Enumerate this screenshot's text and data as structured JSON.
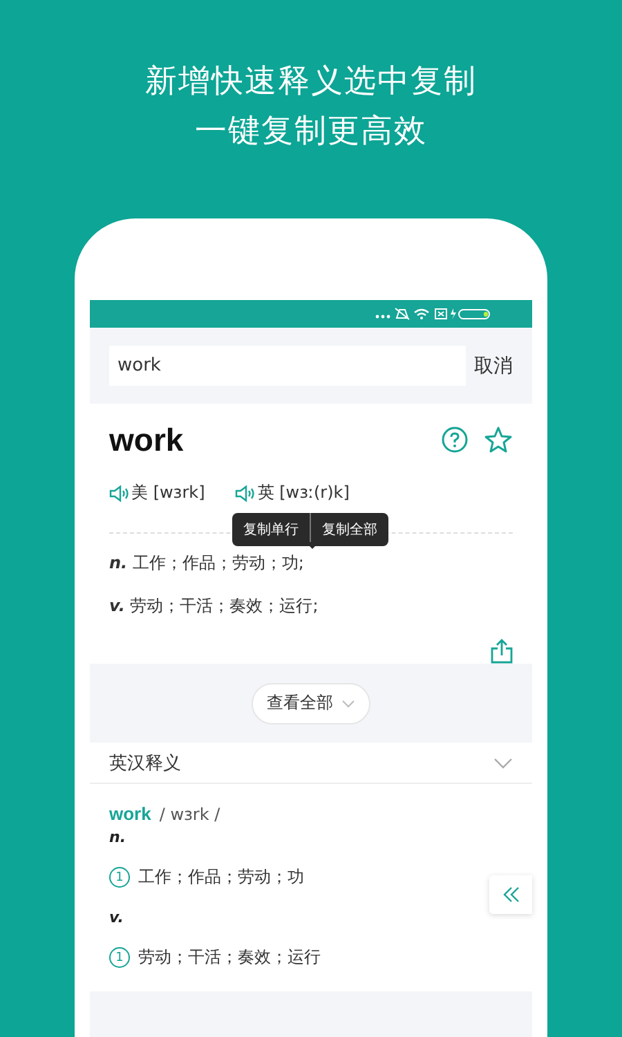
{
  "headline": [
    "新增快速释义选中复制",
    "一键复制更高效"
  ],
  "search": {
    "value": "work",
    "cancel": "取消"
  },
  "word": {
    "headword": "work",
    "pronunciations": [
      {
        "region": "美",
        "phonetic": "[wɜrk]"
      },
      {
        "region": "英",
        "phonetic": "[wɜː(r)k]"
      }
    ]
  },
  "copy_menu": [
    "复制单行",
    "复制全部"
  ],
  "definitions": [
    {
      "pos": "n.",
      "text": "工作；作品；劳动；功;"
    },
    {
      "pos": "v.",
      "text": "劳动；干活；奏效；运行;"
    }
  ],
  "view_all": "查看全部",
  "section": {
    "title": "英汉释义"
  },
  "entry": {
    "word": "work",
    "phonetic": "/ wɜrk /",
    "senses": [
      {
        "pos": "n.",
        "items": [
          {
            "number": "1",
            "text": "工作；作品；劳动；功"
          }
        ]
      },
      {
        "pos": "v.",
        "items": [
          {
            "number": "1",
            "text": "劳动；干活；奏效；运行"
          }
        ]
      }
    ]
  }
}
